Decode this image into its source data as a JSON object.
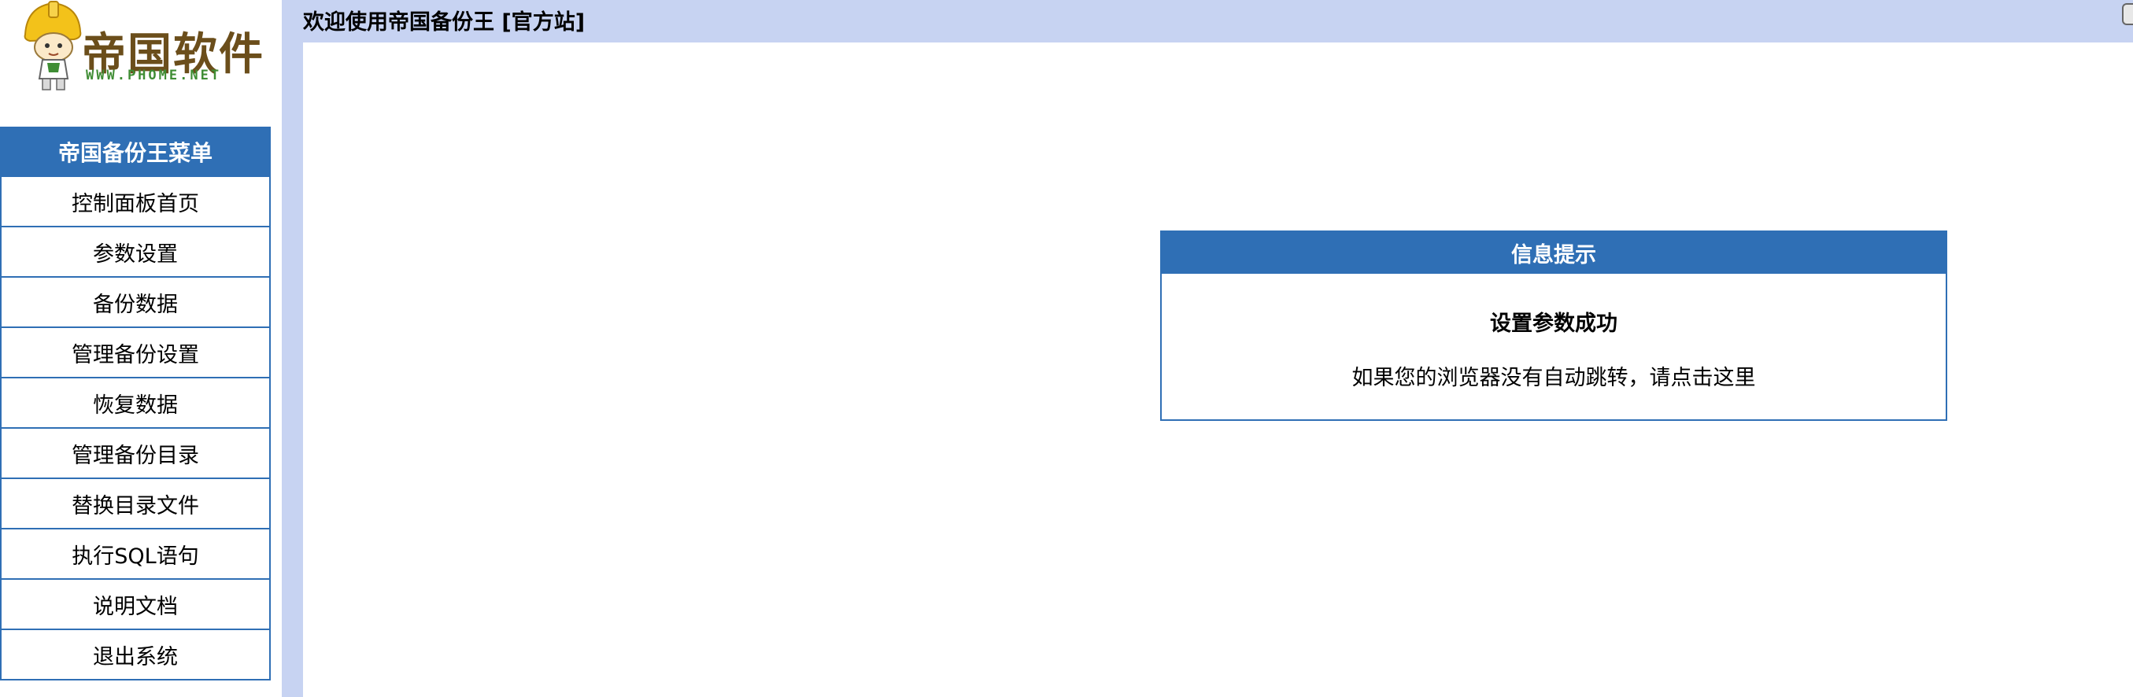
{
  "logo": {
    "brand": "帝国软件",
    "url": "WWW.PHOME.NET"
  },
  "menu": {
    "header": "帝国备份王菜单",
    "items": [
      "控制面板首页",
      "参数设置",
      "备份数据",
      "管理备份设置",
      "恢复数据",
      "管理备份目录",
      "替换目录文件",
      "执行SQL语句",
      "说明文档",
      "退出系统"
    ]
  },
  "topbar": {
    "title": "欢迎使用帝国备份王 [官方站]"
  },
  "message": {
    "header": "信息提示",
    "title": "设置参数成功",
    "link": "如果您的浏览器没有自动跳转，请点击这里"
  },
  "colors": {
    "accent": "#2f6fb5",
    "band": "#c7d3f2"
  }
}
